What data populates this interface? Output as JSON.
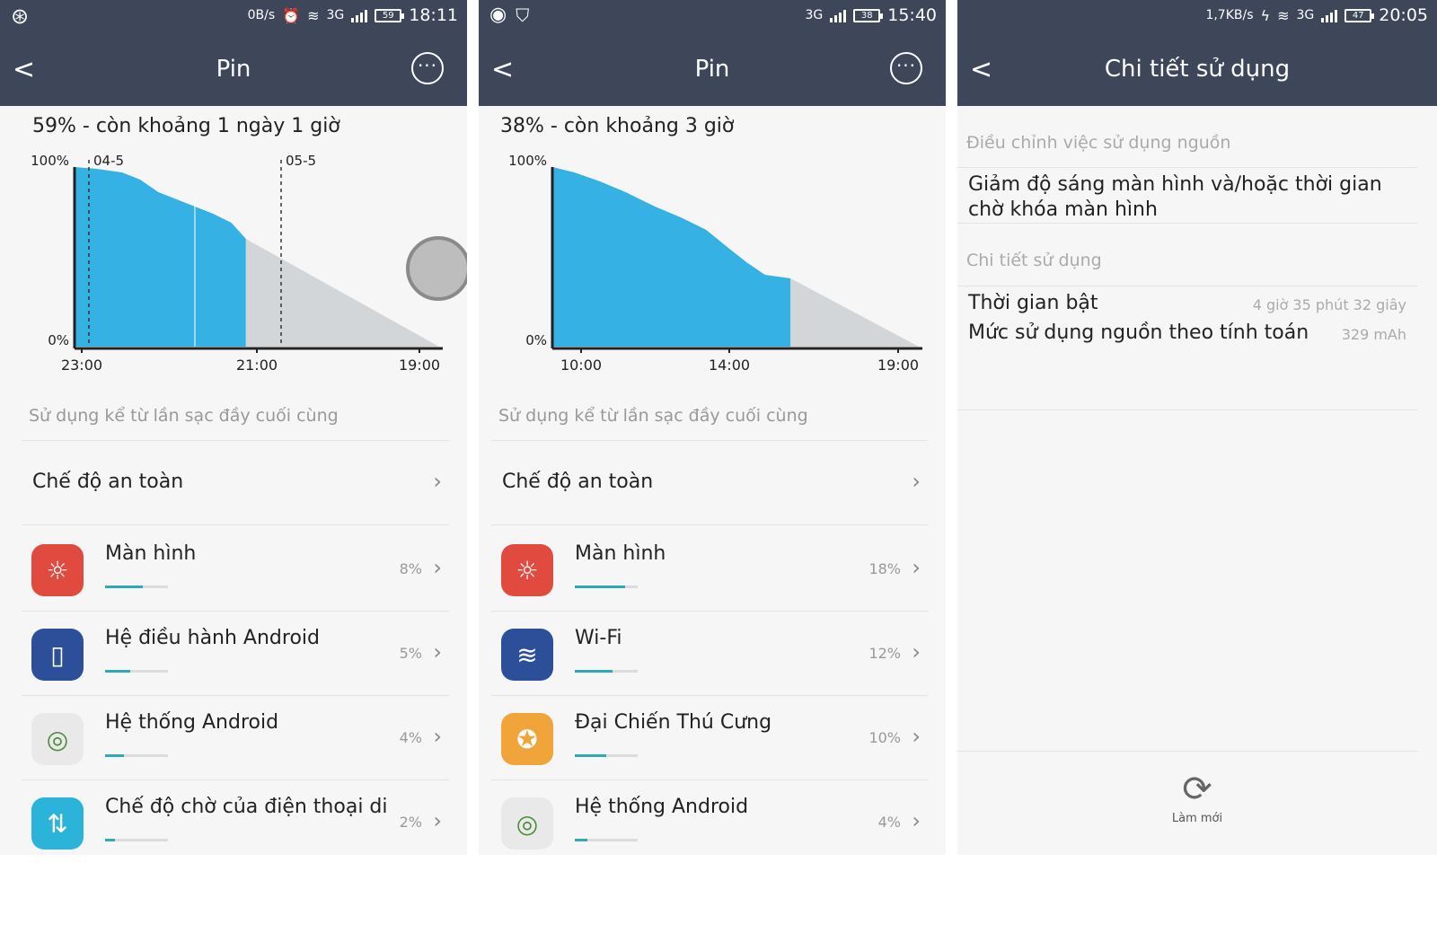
{
  "panels": [
    {
      "status": {
        "speed": "0B/s",
        "net": "3G",
        "battery": "59",
        "time": "18:11"
      },
      "header": {
        "back": "<",
        "title": "Pin",
        "more": "···"
      },
      "summary": "59% - còn khoảng 1 ngày 1 giờ",
      "section_label": "Sử dụng kể từ lần sạc đầy cuối cùng",
      "safe_mode": "Chế độ an toàn",
      "items": [
        {
          "label": "Màn hình",
          "pct": "8%",
          "icon": "sun-icon",
          "color": "#e14b3f",
          "level": 0.6
        },
        {
          "label": "Hệ điều hành Android",
          "pct": "5%",
          "icon": "phone-icon",
          "color": "#2d4f9a",
          "level": 0.4
        },
        {
          "label": "Hệ thống Android",
          "pct": "4%",
          "icon": "android-system-icon",
          "color": "#e9e9e9",
          "level": 0.3
        },
        {
          "label": "Chế độ chờ của điện thoại di đ",
          "pct": "2%",
          "icon": "standby-arrows-icon",
          "color": "#2bb3d9",
          "level": 0.15
        }
      ],
      "chart_data": {
        "type": "area",
        "y_ticks": [
          "100%",
          "0%"
        ],
        "x_ticks": [
          "23:00",
          "21:00",
          "19:00"
        ],
        "markers": [
          "04-5",
          "05-5"
        ],
        "battery_used_points": [
          [
            0,
            100
          ],
          [
            0.06,
            99
          ],
          [
            0.13,
            97
          ],
          [
            0.18,
            93
          ],
          [
            0.23,
            86
          ],
          [
            0.28,
            82
          ],
          [
            0.33,
            78
          ],
          [
            0.38,
            74
          ],
          [
            0.43,
            69
          ],
          [
            0.47,
            60
          ]
        ],
        "projection": {
          "from": [
            0.47,
            60
          ],
          "to": [
            1,
            0
          ]
        },
        "colors": {
          "used": "#35b2e3",
          "projection": "#d3d6d9"
        }
      }
    },
    {
      "status": {
        "net": "3G",
        "battery": "38",
        "time": "15:40"
      },
      "header": {
        "back": "<",
        "title": "Pin",
        "more": "···"
      },
      "summary": "38% - còn khoảng 3 giờ",
      "section_label": "Sử dụng kể từ lần sạc đầy cuối cùng",
      "safe_mode": "Chế độ an toàn",
      "items": [
        {
          "label": "Màn hình",
          "pct": "18%",
          "icon": "sun-icon",
          "color": "#e14b3f",
          "level": 0.8
        },
        {
          "label": "Wi-Fi",
          "pct": "12%",
          "icon": "wifi-icon",
          "color": "#2d4f9a",
          "level": 0.6
        },
        {
          "label": "Đại Chiến Thú Cưng",
          "pct": "10%",
          "icon": "game-pet-icon",
          "color": "#f0a43a",
          "level": 0.5
        },
        {
          "label": "Hệ thống Android",
          "pct": "4%",
          "icon": "android-system-icon",
          "color": "#e9e9e9",
          "level": 0.2
        }
      ],
      "chart_data": {
        "type": "area",
        "y_ticks": [
          "100%",
          "0%"
        ],
        "x_ticks": [
          "10:00",
          "14:00",
          "19:00"
        ],
        "battery_used_points": [
          [
            0,
            100
          ],
          [
            0.06,
            97
          ],
          [
            0.13,
            92
          ],
          [
            0.2,
            86
          ],
          [
            0.28,
            78
          ],
          [
            0.35,
            72
          ],
          [
            0.42,
            65
          ],
          [
            0.48,
            55
          ],
          [
            0.53,
            47
          ],
          [
            0.58,
            40
          ],
          [
            0.65,
            38
          ]
        ],
        "projection": {
          "from": [
            0.65,
            38
          ],
          "to": [
            1,
            0
          ]
        },
        "colors": {
          "used": "#35b2e3",
          "projection": "#d3d6d9"
        }
      }
    },
    {
      "status": {
        "speed": "1,7KB/s",
        "net": "3G",
        "battery": "47",
        "time": "20:05"
      },
      "header": {
        "back": "<",
        "title": "Chi tiết sử dụng"
      },
      "section1_label": "Điều chỉnh việc sử dụng nguồn",
      "tip_line1": "Giảm độ sáng màn hình và/hoặc thời gian",
      "tip_line2": "chờ khóa màn hình",
      "section2_label": "Chi tiết sử dụng",
      "on_time_label": "Thời gian bật",
      "on_time_value": "4 giờ 35 phút 32 giây",
      "power_label": "Mức sử dụng nguồn theo tính toán",
      "power_value": "329 mAh",
      "refresh_label": "Làm mới"
    }
  ]
}
